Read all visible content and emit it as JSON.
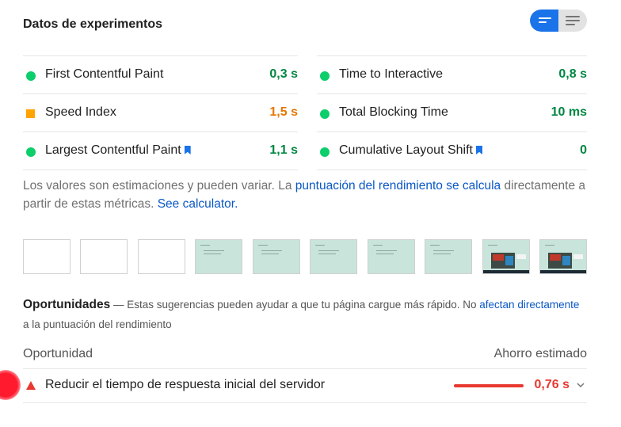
{
  "header": {
    "title": "Datos de experimentos"
  },
  "metrics": {
    "left": [
      {
        "name": "First Contentful Paint",
        "value": "0,3 s",
        "rating": "green",
        "bookmark": false
      },
      {
        "name": "Speed Index",
        "value": "1,5 s",
        "rating": "orange",
        "bookmark": false
      },
      {
        "name": "Largest Contentful Paint",
        "value": "1,1 s",
        "rating": "green",
        "bookmark": true
      }
    ],
    "right": [
      {
        "name": "Time to Interactive",
        "value": "0,8 s",
        "rating": "green",
        "bookmark": false
      },
      {
        "name": "Total Blocking Time",
        "value": "10 ms",
        "rating": "green",
        "bookmark": false
      },
      {
        "name": "Cumulative Layout Shift",
        "value": "0",
        "rating": "green",
        "bookmark": true
      }
    ]
  },
  "description": {
    "text1": "Los valores son estimaciones y pueden variar. La ",
    "link1": "puntuación del rendimiento se calcula",
    "text2": " directamente a partir de estas métricas. ",
    "link2": "See calculator."
  },
  "opportunities": {
    "title": "Oportunidades",
    "dash": " — Estas sugerencias pueden ayudar a que tu página cargue más rápido. No ",
    "link": "afectan directamente",
    "tail": " a la puntuación del rendimiento",
    "col_left": "Oportunidad",
    "col_right": "Ahorro estimado",
    "items": [
      {
        "title": "Reducir el tiempo de respuesta inicial del servidor",
        "savings": "0,76 s"
      }
    ]
  },
  "colors": {
    "pass": "#0cce6b",
    "average": "#ffa400",
    "fail": "#e8382f",
    "accent": "#1a73e8"
  }
}
